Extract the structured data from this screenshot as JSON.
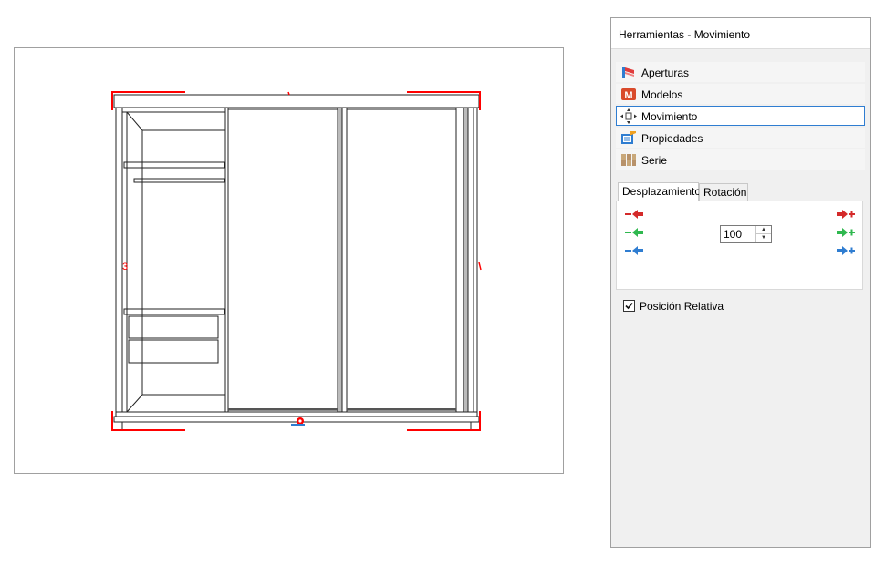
{
  "panel": {
    "title": "Herramientas - Movimiento",
    "nav": [
      {
        "label": "Aperturas",
        "icon": "aperturas-icon",
        "active": false
      },
      {
        "label": "Modelos",
        "icon": "modelos-icon",
        "active": false
      },
      {
        "label": "Movimiento",
        "icon": "movimiento-icon",
        "active": true
      },
      {
        "label": "Propiedades",
        "icon": "propiedades-icon",
        "active": false
      },
      {
        "label": "Serie",
        "icon": "serie-icon",
        "active": false
      }
    ],
    "tabs": [
      {
        "label": "Desplazamiento",
        "active": true
      },
      {
        "label": "Rotación",
        "active": false
      }
    ],
    "axis_colors": {
      "x": "#d42a2a",
      "y": "#2fb84f",
      "z": "#2f7dd1"
    },
    "step_value": "100",
    "relative_label": "Posición Relativa",
    "relative_checked": true
  },
  "viewport": {
    "selection_color": "#ff0000"
  }
}
